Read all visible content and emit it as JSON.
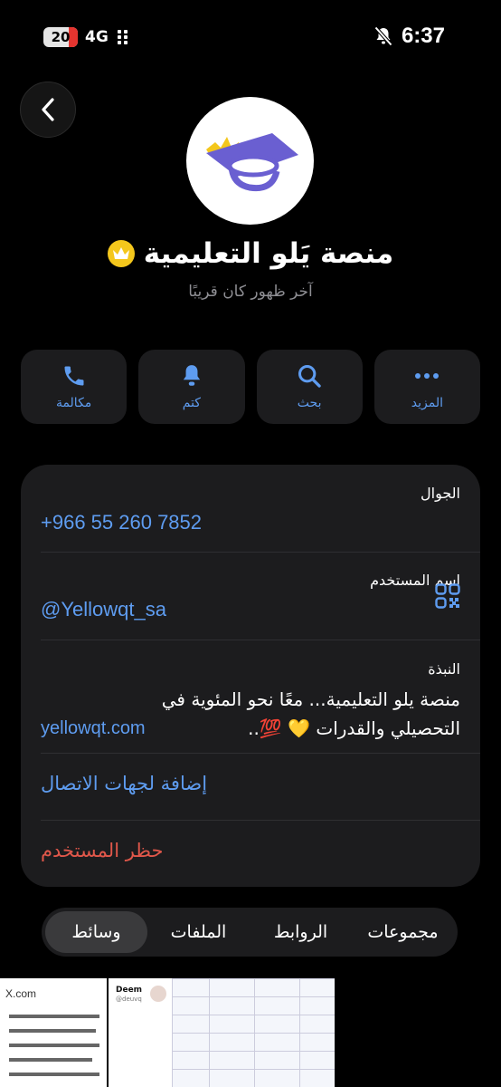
{
  "status_bar": {
    "battery": "20",
    "network": "4G",
    "time": "6:37",
    "icons": [
      "signal-dots-icon",
      "bell-slash-icon"
    ]
  },
  "nav": {
    "back_icon": "chevron-left-icon"
  },
  "profile": {
    "avatar_icon": "graduation-cap-crown-logo",
    "badge_icon": "crown-icon",
    "name": "منصة يَلو التعليمية",
    "last_seen": "آخر ظهور كان قريبًا"
  },
  "actions": [
    {
      "label": "مكالمة",
      "icon": "phone-icon"
    },
    {
      "label": "كتم",
      "icon": "bell-icon"
    },
    {
      "label": "بحث",
      "icon": "search-icon"
    },
    {
      "label": "المزيد",
      "icon": "more-icon"
    }
  ],
  "info": {
    "phone_caption": "الجوال",
    "phone_value": "+966 55 260 7852",
    "username_caption": "اسم المستخدم",
    "username_value": "@Yellowqt_sa",
    "bio_caption": "النبذة",
    "bio_line1": "منصة يلو التعليمية... معًا نحو المئوية في",
    "bio_line2": "التحصيلي والقدرات 💛 💯..",
    "bio_link": "yellowqt.com",
    "add_contact": "إضافة لجهات الاتصال",
    "block_user": "حظر المستخدم"
  },
  "tabs": [
    {
      "label": "وسائط",
      "active": true
    },
    {
      "label": "الملفات",
      "active": false
    },
    {
      "label": "الروابط",
      "active": false
    },
    {
      "label": "مجموعات",
      "active": false
    }
  ],
  "media": {
    "tile1_text": "X.com",
    "tile2_author": "Deem",
    "tile2_handle": "@deuvq"
  },
  "colors": {
    "accent": "#5e9cf0",
    "danger": "#e0574a",
    "card": "#1c1c1e",
    "background": "#000000"
  }
}
